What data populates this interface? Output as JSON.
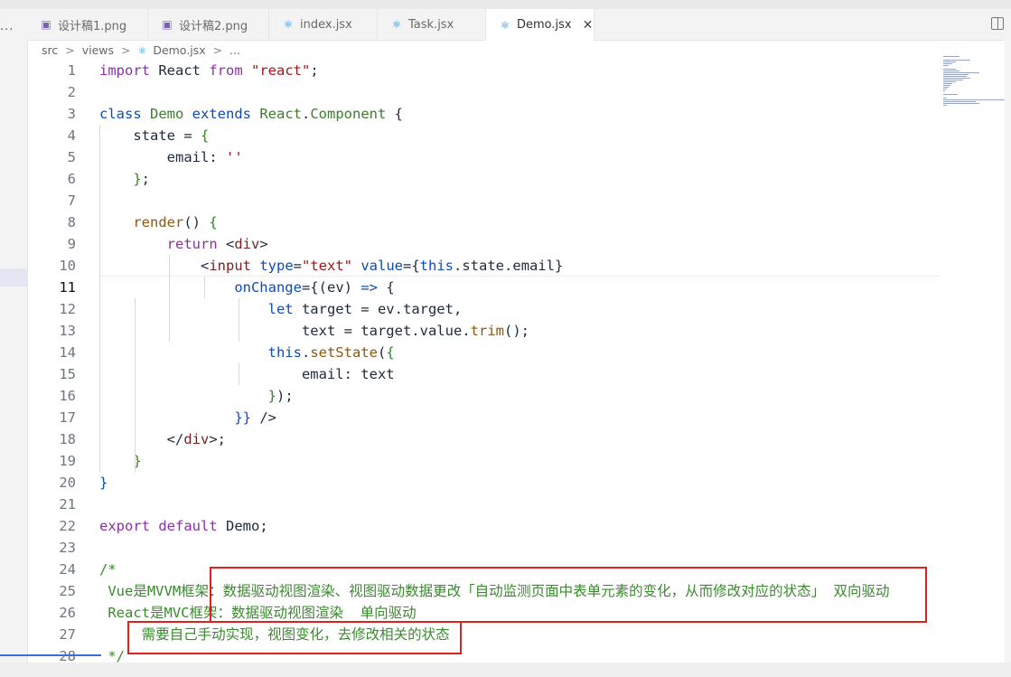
{
  "tabs": [
    {
      "label": "设计稿1.png",
      "icon": "image-icon",
      "active": false
    },
    {
      "label": "设计稿2.png",
      "icon": "image-icon",
      "active": false
    },
    {
      "label": "index.jsx",
      "icon": "react-icon",
      "active": false
    },
    {
      "label": "Task.jsx",
      "icon": "react-icon",
      "active": false
    },
    {
      "label": "Demo.jsx",
      "icon": "react-icon",
      "active": true
    }
  ],
  "tab_close": "✕",
  "side_more": "···",
  "breadcrumb": {
    "parts": [
      "src",
      "views",
      "Demo.jsx",
      "..."
    ],
    "sep": ">"
  },
  "current_line": 11,
  "code_lines": [
    {
      "n": 1,
      "tokens": [
        [
          "import ",
          "k-purple"
        ],
        [
          "React ",
          "k-plain"
        ],
        [
          "from ",
          "k-purple"
        ],
        [
          "\"react\"",
          "k-str"
        ],
        [
          ";",
          "k-plain"
        ]
      ]
    },
    {
      "n": 2,
      "tokens": []
    },
    {
      "n": 3,
      "tokens": [
        [
          "class ",
          "k-blue"
        ],
        [
          "Demo ",
          "k-green"
        ],
        [
          "extends ",
          "k-blue"
        ],
        [
          "React",
          "k-green"
        ],
        [
          ".",
          "k-plain"
        ],
        [
          "Component ",
          "k-green"
        ],
        [
          "{",
          "k-plain"
        ]
      ]
    },
    {
      "n": 4,
      "tokens": [
        [
          "    state ",
          "k-plain"
        ],
        [
          "= ",
          "k-plain"
        ],
        [
          "{",
          "k-green"
        ]
      ]
    },
    {
      "n": 5,
      "tokens": [
        [
          "        email",
          "k-plain"
        ],
        [
          ": ",
          "k-plain"
        ],
        [
          "''",
          "k-str"
        ]
      ]
    },
    {
      "n": 6,
      "tokens": [
        [
          "    ",
          "k-plain"
        ],
        [
          "}",
          "k-green"
        ],
        [
          ";",
          "k-plain"
        ]
      ]
    },
    {
      "n": 7,
      "tokens": []
    },
    {
      "n": 8,
      "tokens": [
        [
          "    ",
          "k-plain"
        ],
        [
          "render",
          "k-fn"
        ],
        [
          "() ",
          "k-plain"
        ],
        [
          "{",
          "k-green"
        ]
      ]
    },
    {
      "n": 9,
      "tokens": [
        [
          "        ",
          "k-plain"
        ],
        [
          "return ",
          "k-purple"
        ],
        [
          "<",
          "k-plain"
        ],
        [
          "div",
          "k-tag"
        ],
        [
          ">",
          "k-plain"
        ]
      ]
    },
    {
      "n": 10,
      "tokens": [
        [
          "            <",
          "k-plain"
        ],
        [
          "input ",
          "k-tag"
        ],
        [
          "type",
          "k-blue"
        ],
        [
          "=",
          "k-plain"
        ],
        [
          "\"text\" ",
          "k-str"
        ],
        [
          "value",
          "k-blue"
        ],
        [
          "={",
          "k-plain"
        ],
        [
          "this",
          "k-blue"
        ],
        [
          ".",
          "k-plain"
        ],
        [
          "state",
          "k-plain"
        ],
        [
          ".",
          "k-plain"
        ],
        [
          "email",
          "k-plain"
        ],
        [
          "}",
          "k-plain"
        ]
      ]
    },
    {
      "n": 11,
      "tokens": [
        [
          "                ",
          "k-plain"
        ],
        [
          "onChange",
          "k-blue"
        ],
        [
          "={",
          "k-plain"
        ],
        [
          "(",
          "k-plain"
        ],
        [
          "ev",
          "k-plain"
        ],
        [
          ") ",
          "k-plain"
        ],
        [
          "=> ",
          "k-blue"
        ],
        [
          "{",
          "k-plain"
        ]
      ]
    },
    {
      "n": 12,
      "tokens": [
        [
          "                    ",
          "k-plain"
        ],
        [
          "let ",
          "k-blue"
        ],
        [
          "target ",
          "k-plain"
        ],
        [
          "= ",
          "k-plain"
        ],
        [
          "ev",
          "k-plain"
        ],
        [
          ".",
          "k-plain"
        ],
        [
          "target",
          "k-plain"
        ],
        [
          ",",
          "k-plain"
        ]
      ]
    },
    {
      "n": 13,
      "tokens": [
        [
          "                        text ",
          "k-plain"
        ],
        [
          "= ",
          "k-plain"
        ],
        [
          "target",
          "k-plain"
        ],
        [
          ".",
          "k-plain"
        ],
        [
          "value",
          "k-plain"
        ],
        [
          ".",
          "k-plain"
        ],
        [
          "trim",
          "k-fn"
        ],
        [
          "();",
          "k-plain"
        ]
      ]
    },
    {
      "n": 14,
      "tokens": [
        [
          "                    ",
          "k-plain"
        ],
        [
          "this",
          "k-blue"
        ],
        [
          ".",
          "k-plain"
        ],
        [
          "setState",
          "k-fn"
        ],
        [
          "(",
          "k-plain"
        ],
        [
          "{",
          "k-green"
        ]
      ]
    },
    {
      "n": 15,
      "tokens": [
        [
          "                        email",
          "k-plain"
        ],
        [
          ": ",
          "k-plain"
        ],
        [
          "text",
          "k-plain"
        ]
      ]
    },
    {
      "n": 16,
      "tokens": [
        [
          "                    ",
          "k-plain"
        ],
        [
          "}",
          "k-green"
        ],
        [
          ");",
          "k-plain"
        ]
      ]
    },
    {
      "n": 17,
      "tokens": [
        [
          "                ",
          "k-plain"
        ],
        [
          "}} ",
          "k-blue"
        ],
        [
          "/>",
          "k-plain"
        ]
      ]
    },
    {
      "n": 18,
      "tokens": [
        [
          "        </",
          "k-plain"
        ],
        [
          "div",
          "k-tag"
        ],
        [
          ">;",
          "k-plain"
        ]
      ]
    },
    {
      "n": 19,
      "tokens": [
        [
          "    ",
          "k-plain"
        ],
        [
          "}",
          "k-green"
        ]
      ]
    },
    {
      "n": 20,
      "tokens": [
        [
          "}",
          "k-blue"
        ]
      ]
    },
    {
      "n": 21,
      "tokens": []
    },
    {
      "n": 22,
      "tokens": [
        [
          "export ",
          "k-purple"
        ],
        [
          "default ",
          "k-purple"
        ],
        [
          "Demo",
          "k-plain"
        ],
        [
          ";",
          "k-plain"
        ]
      ]
    },
    {
      "n": 23,
      "tokens": []
    },
    {
      "n": 24,
      "tokens": [
        [
          "/*",
          "k-com"
        ]
      ]
    },
    {
      "n": 25,
      "tokens": [
        [
          " Vue是MVVM框架：数据驱动视图渲染、视图驱动数据更改「自动监测页面中表单元素的变化，从而修改对应的状态」 双向驱动",
          "k-com"
        ]
      ]
    },
    {
      "n": 26,
      "tokens": [
        [
          " React是MVC框架：数据驱动视图渲染  单向驱动",
          "k-com"
        ]
      ]
    },
    {
      "n": 27,
      "tokens": [
        [
          "     需要自己手动实现，视图变化，去修改相关的状态",
          "k-com"
        ]
      ]
    },
    {
      "n": 28,
      "tokens": [
        [
          " */",
          "k-com"
        ]
      ]
    }
  ]
}
